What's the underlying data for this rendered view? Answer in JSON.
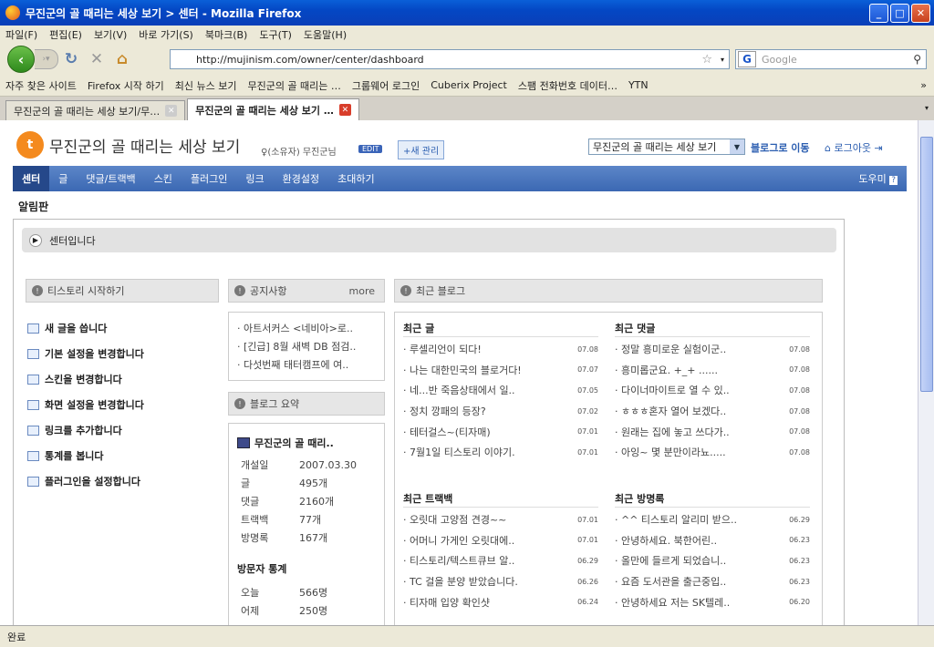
{
  "window": {
    "title": "무진군의 골 때리는 세상 보기 > 센터 - Mozilla Firefox"
  },
  "menu": [
    "파일(F)",
    "편집(E)",
    "보기(V)",
    "바로 가기(S)",
    "북마크(B)",
    "도구(T)",
    "도움말(H)"
  ],
  "url": "http://mujinism.com/owner/center/dashboard",
  "search_placeholder": "Google",
  "bookmarks": [
    "자주 찾은 사이트",
    "Firefox 시작 하기",
    "최신 뉴스 보기",
    "무진군의 골 때리는 …",
    "그룹웨어 로그인",
    "Cuberix Project",
    "스팸 전화번호 데이터…",
    "YTN"
  ],
  "tabs": [
    "무진군의 골 때리는 세상 보기/무…",
    "무진군의 골 때리는 세상 보기 …"
  ],
  "status": "완료",
  "header": {
    "blog_title": "무진군의 골 때리는 세상 보기",
    "owner": "♀(소유자) 무진군님",
    "edit": "EDIT",
    "new_manage": "+새 관리",
    "blog_select": "무진군의 골 때리는 세상 보기",
    "go_blog": "블로그로 이동",
    "logout": "로그아웃"
  },
  "nav": {
    "items": [
      "센터",
      "글",
      "댓글/트랙백",
      "스킨",
      "플러그인",
      "링크",
      "환경설정",
      "초대하기"
    ],
    "help": "도우미"
  },
  "page_label": "알림판",
  "center_label": "센터입니다",
  "start": {
    "title": "티스토리 시작하기",
    "items": [
      "새 글을 씁니다",
      "기본 설정을 변경합니다",
      "스킨을 변경합니다",
      "화면 설정을 변경합니다",
      "링크를 추가합니다",
      "통계를 봅니다",
      "플러그인을 설정합니다"
    ]
  },
  "notice": {
    "title": "공지사항",
    "more": "more",
    "items": [
      "아트서커스 <네비아>로..",
      "[긴급] 8월 새벽 DB 점검..",
      "다섯번째 태터캠프에 여.."
    ]
  },
  "summary": {
    "title": "블로그 요약",
    "blog": "무진군의 골 때리..",
    "rows": [
      [
        "개설일",
        "2007.03.30"
      ],
      [
        "글",
        "495개"
      ],
      [
        "댓글",
        "2160개"
      ],
      [
        "트랙백",
        "77개"
      ],
      [
        "방명록",
        "167개"
      ]
    ],
    "visit_title": "방문자 통계",
    "visits": [
      [
        "오늘",
        "566명"
      ],
      [
        "어제",
        "250명"
      ]
    ]
  },
  "recent": {
    "title": "최근 블로그",
    "posts": {
      "title": "최근 글",
      "items": [
        [
          "루셀리언이 되다!",
          "07.08"
        ],
        [
          "나는 대한민국의 블로거다!",
          "07.07"
        ],
        [
          "네...반 죽음상태에서 일..",
          "07.05"
        ],
        [
          "정치 깡패의 등장?",
          "07.02"
        ],
        [
          "테터걸스~(티자매)",
          "07.01"
        ],
        [
          "7월1일 티스토리 이야기.",
          "07.01"
        ]
      ]
    },
    "comments": {
      "title": "최근 댓글",
      "items": [
        [
          "정말 흥미로운 실험이군..",
          "07.08"
        ],
        [
          "흥미롭군요. +_+ ......",
          "07.08"
        ],
        [
          "다이너마이트로 열 수 있..",
          "07.08"
        ],
        [
          "ㅎㅎㅎ혼자 열어 보겠다..",
          "07.08"
        ],
        [
          "원래는 집에 놓고 쓰다가..",
          "07.08"
        ],
        [
          "아잉~ 몇 분만이라뇨.....",
          "07.08"
        ]
      ]
    },
    "trackbacks": {
      "title": "최근 트랙백",
      "items": [
        [
          "오릿대 고양점 견경~~",
          "07.01"
        ],
        [
          "어머니 가게인 오릿대에..",
          "07.01"
        ],
        [
          "티스토리/텍스트큐브 알..",
          "06.29"
        ],
        [
          "TC 걸을 분양 받았습니다.",
          "06.26"
        ],
        [
          "티자매 입양 확인샷",
          "06.24"
        ]
      ]
    },
    "guestbook": {
      "title": "최근 방명록",
      "items": [
        [
          "^^ 티스토리 알리미 받으..",
          "06.29"
        ],
        [
          "안녕하세요. 북한어린..",
          "06.23"
        ],
        [
          "올만에 들르게 되었습니..",
          "06.23"
        ],
        [
          "요즘 도서관을 출근중입..",
          "06.23"
        ],
        [
          "안녕하세요 저는 SK텔레..",
          "06.20"
        ]
      ]
    }
  }
}
